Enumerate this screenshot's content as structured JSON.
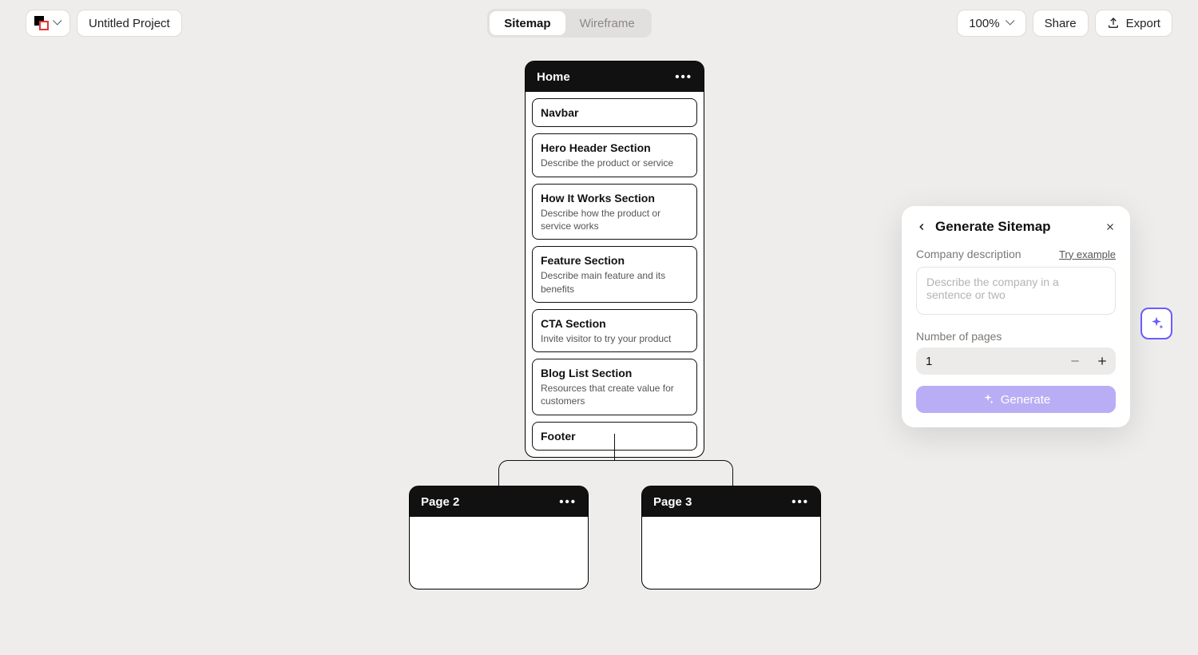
{
  "header": {
    "project_name": "Untitled Project",
    "tabs": {
      "sitemap": "Sitemap",
      "wireframe": "Wireframe"
    },
    "zoom": "100%",
    "share": "Share",
    "export": "Export"
  },
  "sitemap": {
    "root": {
      "title": "Home",
      "sections": [
        {
          "title": "Navbar",
          "desc": ""
        },
        {
          "title": "Hero Header Section",
          "desc": "Describe the product or service"
        },
        {
          "title": "How It Works Section",
          "desc": "Describe how the product or service works"
        },
        {
          "title": "Feature Section",
          "desc": "Describe main feature and its benefits"
        },
        {
          "title": "CTA Section",
          "desc": "Invite visitor to try your product"
        },
        {
          "title": "Blog List Section",
          "desc": "Resources that create value for customers"
        },
        {
          "title": "Footer",
          "desc": ""
        }
      ]
    },
    "children": [
      {
        "title": "Page 2"
      },
      {
        "title": "Page 3"
      }
    ]
  },
  "panel": {
    "title": "Generate Sitemap",
    "label_desc": "Company description",
    "try_example": "Try example",
    "placeholder": "Describe the company in a sentence or two",
    "label_pages": "Number of pages",
    "pages_value": "1",
    "generate": "Generate"
  }
}
